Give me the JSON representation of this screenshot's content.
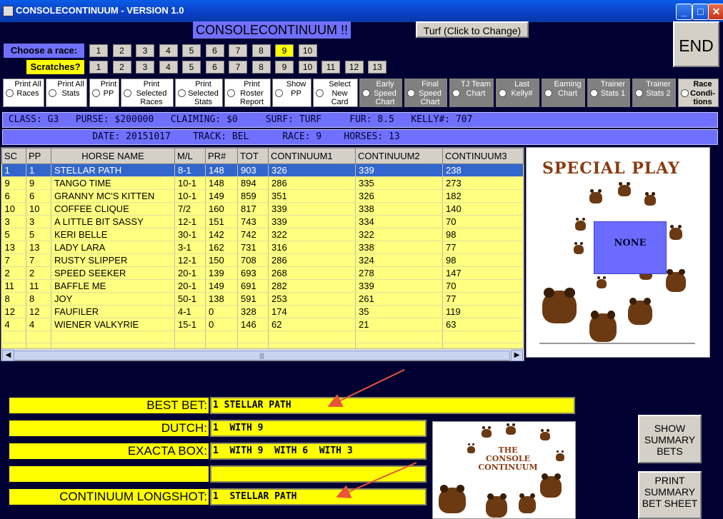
{
  "window": {
    "title": "CONSOLECONTINUUM - VERSION 1.0"
  },
  "header": {
    "app_title": "CONSOLECONTINUUM !!",
    "surface_button": "Turf (Click to Change)",
    "end_button": "END"
  },
  "race_select": {
    "label": "Choose  a race:",
    "numbers": [
      "1",
      "2",
      "3",
      "4",
      "5",
      "6",
      "7",
      "8",
      "9",
      "10"
    ],
    "selected": "9"
  },
  "scratches": {
    "label": "Scratches?",
    "numbers": [
      "1",
      "2",
      "3",
      "4",
      "5",
      "6",
      "7",
      "8",
      "9",
      "10",
      "11",
      "12",
      "13"
    ]
  },
  "options": [
    {
      "label": "Print All Races"
    },
    {
      "label": "Print All Stats"
    },
    {
      "label": "Print PP"
    },
    {
      "label": "Print Selected Races"
    },
    {
      "label": "Print Selected Stats"
    },
    {
      "label": "Print Roster Report"
    },
    {
      "label": "Show PP"
    },
    {
      "label": "Select New Card"
    },
    {
      "label": "Early Speed Chart"
    },
    {
      "label": "Final Speed Chart"
    },
    {
      "label": "TJ Team Chart"
    },
    {
      "label": "Last Kelly#"
    },
    {
      "label": "Earning Chart"
    },
    {
      "label": "Trainer Stats 1"
    },
    {
      "label": "Trainer Stats 2"
    },
    {
      "label": "Race Condi- tions"
    }
  ],
  "info": {
    "line1": " CLASS: G3   PURSE: $200000   CLAIMING: $0     SURF: TURF     FUR: 8.5   KELLY#: 707",
    "line2": "                DATE: 20151017    TRACK: BEL      RACE: 9    HORSES: 13"
  },
  "table": {
    "columns": [
      "SC",
      "PP",
      "HORSE NAME",
      "M/L",
      "PR#",
      "TOT",
      "CONTINUUM1",
      "CONTINUUM2",
      "CONTINUUM3"
    ],
    "rows": [
      [
        "1",
        "1",
        "STELLAR PATH",
        "8-1",
        "148",
        "903",
        "326",
        "339",
        "238"
      ],
      [
        "9",
        "9",
        "TANGO TIME",
        "10-1",
        "148",
        "894",
        "286",
        "335",
        "273"
      ],
      [
        "6",
        "6",
        "GRANNY MC'S KITTEN",
        "10-1",
        "149",
        "859",
        "351",
        "326",
        "182"
      ],
      [
        "10",
        "10",
        "COFFEE CLIQUE",
        "7/2",
        "160",
        "817",
        "339",
        "338",
        "140"
      ],
      [
        "3",
        "3",
        "A LITTLE BIT SASSY",
        "12-1",
        "151",
        "743",
        "339",
        "334",
        "70"
      ],
      [
        "5",
        "5",
        "KERI BELLE",
        "30-1",
        "142",
        "742",
        "322",
        "322",
        "98"
      ],
      [
        "13",
        "13",
        "LADY LARA",
        "3-1",
        "162",
        "731",
        "316",
        "338",
        "77"
      ],
      [
        "7",
        "7",
        "RUSTY SLIPPER",
        "12-1",
        "150",
        "708",
        "286",
        "324",
        "98"
      ],
      [
        "2",
        "2",
        "SPEED SEEKER",
        "20-1",
        "139",
        "693",
        "268",
        "278",
        "147"
      ],
      [
        "11",
        "11",
        "BAFFLE ME",
        "20-1",
        "149",
        "691",
        "282",
        "339",
        "70"
      ],
      [
        "8",
        "8",
        "JOY",
        "50-1",
        "138",
        "591",
        "253",
        "261",
        "77"
      ],
      [
        "12",
        "12",
        "FAUFILER",
        "4-1",
        "0",
        "328",
        "174",
        "35",
        "119"
      ],
      [
        "4",
        "4",
        "WIENER VALKYRIE",
        "15-1",
        "0",
        "146",
        "62",
        "21",
        "63"
      ]
    ],
    "selected_row": 0
  },
  "special_play": {
    "title": "SPECIAL PLAY",
    "value": "NONE"
  },
  "bets": {
    "best_bet": {
      "label": "BEST BET:",
      "value": "1 STELLAR PATH"
    },
    "dutch": {
      "label": "DUTCH:",
      "value": "1  WITH 9"
    },
    "exacta": {
      "label": "EXACTA BOX:",
      "value": "1  WITH 9  WITH 6  WITH 3"
    },
    "blank": {
      "label": "",
      "value": ""
    },
    "longshot": {
      "label": "CONTINUUM LONGSHOT:",
      "value": "1  STELLAR PATH"
    }
  },
  "logo": {
    "line1": "THE",
    "line2": "CONSOLE",
    "line3": "CONTINUUM"
  },
  "side_buttons": {
    "show_summary": "SHOW SUMMARY BETS",
    "print_summary": "PRINT SUMMARY BET SHEET"
  },
  "colors": {
    "background": "#000033",
    "accent_blue": "#7070ff",
    "highlight_yellow": "#ffff00",
    "table_yellow": "#ffff80",
    "selection": "#3366cc",
    "arrow": "#e8553a"
  }
}
